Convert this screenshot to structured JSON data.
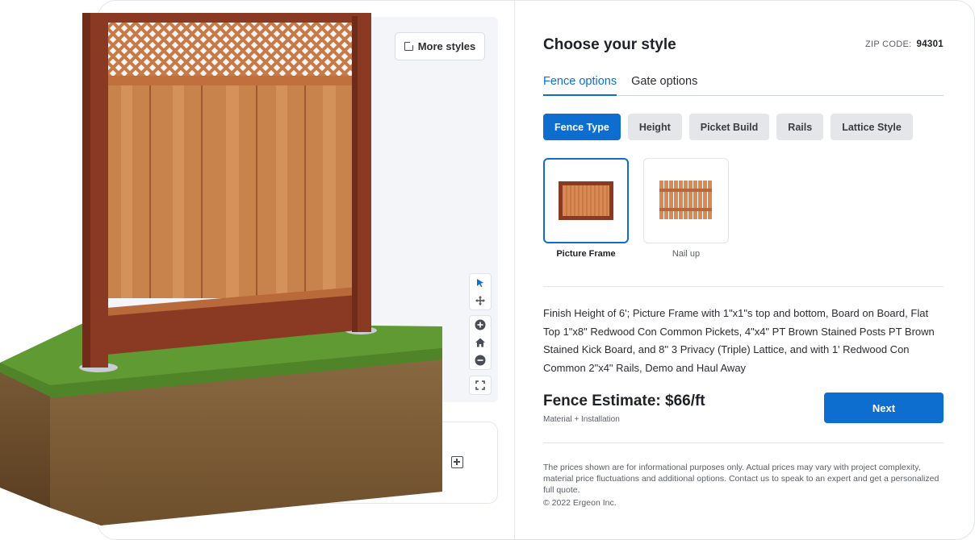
{
  "viewer": {
    "more_styles_label": "More styles"
  },
  "config": {
    "title": "Choose your style",
    "zip_label": "ZIP CODE:",
    "zip_value": "94301",
    "tabs": [
      {
        "label": "Fence options",
        "active": true
      },
      {
        "label": "Gate options",
        "active": false
      }
    ],
    "chips": [
      {
        "label": "Fence Type",
        "active": true
      },
      {
        "label": "Height",
        "active": false
      },
      {
        "label": "Picket Build",
        "active": false
      },
      {
        "label": "Rails",
        "active": false
      },
      {
        "label": "Lattice Style",
        "active": false
      }
    ],
    "options": [
      {
        "label": "Picture Frame",
        "selected": true
      },
      {
        "label": "Nail up",
        "selected": false
      }
    ],
    "description": "Finish Height of 6'; Picture Frame with 1\"x1\"s top and bottom, Board on Board, Flat Top 1\"x8\" Redwood Con Common Pickets, 4\"x4\" PT Brown Stained Posts PT Brown Stained Kick Board, and 8'' 3 Privacy (Triple) Lattice, and with 1' Redwood Con Common 2\"x4\" Rails, Demo and Haul Away",
    "estimate": "Fence Estimate: $66/ft",
    "estimate_sub": "Material + Installation",
    "next_label": "Next",
    "disclaimer": "The prices shown are for informational purposes only. Actual prices may vary with project complexity, material price fluctuations and additional options. Contact us to speak to an expert and get a personalized full quote.",
    "copyright": "© 2022 Ergeon Inc."
  },
  "colors": {
    "accent": "#0e6ecf",
    "chip_bg": "#e4e6ea",
    "post": "#8a3a22",
    "board": "#c8834c"
  }
}
